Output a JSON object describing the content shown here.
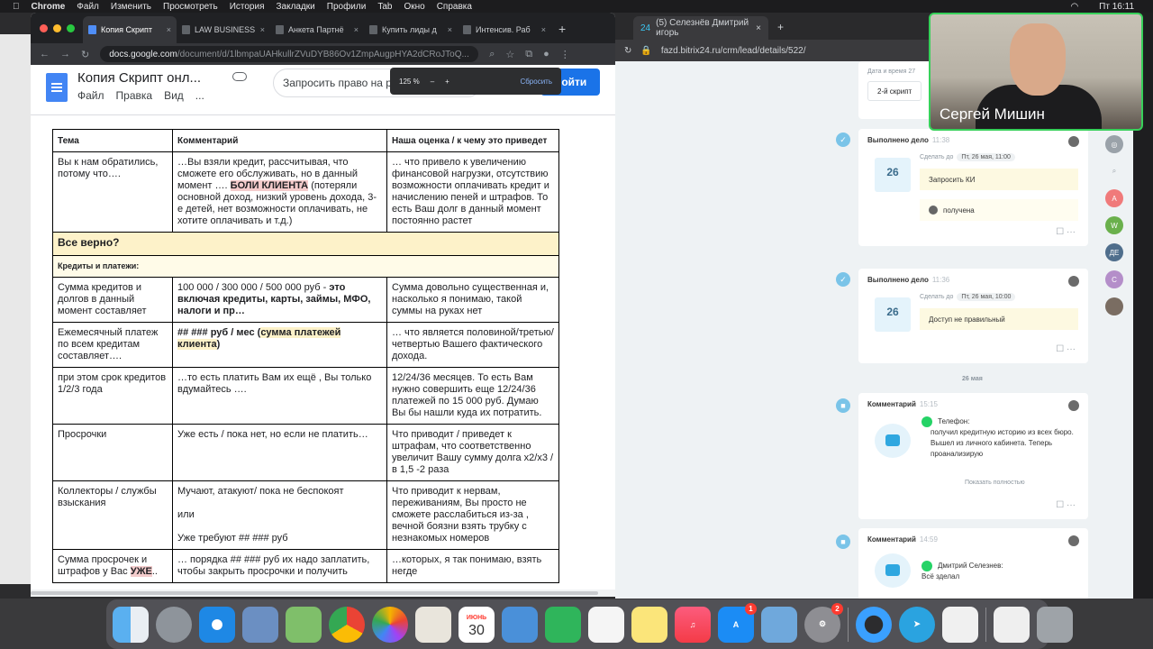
{
  "menubar": {
    "app": "Chrome",
    "items": [
      "Файл",
      "Изменить",
      "Просмотреть",
      "История",
      "Закладки",
      "Профили",
      "Tab",
      "Окно",
      "Справка"
    ],
    "clock": "Пт 16:11"
  },
  "browser_docs": {
    "tabs": [
      {
        "label": "Копия Скрипт",
        "active": true
      },
      {
        "label": "LAW BUSINESS",
        "active": false
      },
      {
        "label": "Анкета Партнё",
        "active": false
      },
      {
        "label": "Купить лиды д",
        "active": false
      },
      {
        "label": "Интенсив. Раб",
        "active": false
      }
    ],
    "new_tab": "+",
    "url_host": "docs.google.com",
    "url_path": "/document/d/1lbmpaUAHkullrZVuDYB86Ov1ZmpAugpHYA2dCRoJToQ...",
    "zoom_popup": {
      "value": "125 %",
      "minus": "–",
      "plus": "+",
      "reset": "Сбросить"
    }
  },
  "doc": {
    "title": "Копия Скрипт онл...",
    "menu": [
      "Файл",
      "Правка",
      "Вид",
      "..."
    ],
    "request_button": "Запросить право на редактирование",
    "login_button": "Войти"
  },
  "script_table": {
    "headers": [
      "Тема",
      "Комментарий",
      "Наша оценка / к чему это приведет"
    ],
    "row1": {
      "c1": "Вы к нам обратились, потому что….",
      "c2_before": "…Вы взяли кредит, рассчитывая, что сможете его обслуживать, но в данный момент ….",
      "c2_highlight": "БОЛИ КЛИЕНТА",
      "c2_after": "(потеряли основной доход, низкий уровень дохода, 3-е детей, нет возможности оплачивать, не хотите оплачивать и т.д.)",
      "c3": "… что привело к увеличению финансовой нагрузки, отсутствию возможности оплачивать кредит и начислению пеней и штрафов. То есть Ваш долг в данный момент постоянно растет"
    },
    "band1": "Все верно?",
    "band2": "Кредиты и платежи:",
    "row2": {
      "c1": "Сумма кредитов и долгов в данный момент составляет",
      "c2_plain": "100 000 / 300 000 / 500 000 руб -",
      "c2_bold": "это включая кредиты, карты, займы, МФО, налоги и пр…",
      "c3": "Сумма довольно существенная и, насколько я понимаю, такой суммы на руках нет"
    },
    "row3": {
      "c1": "Ежемесячный платеж по всем кредитам составляет….",
      "c2_plain": "## ### руб / мес (",
      "c2_highlight": "сумма платежей клиента",
      "c2_close": ")",
      "c3": "… что является половиной/третью/ четвертью Вашего фактического дохода."
    },
    "row4": {
      "c1": "при этом срок кредитов 1/2/3 года",
      "c2": "…то есть  платить Вам их ещё , Вы только вдумайтесь ….",
      "c3": "12/24/36 месяцев. То есть Вам нужно совершить еще 12/24/36 платежей по 15 000 руб. Думаю Вы бы нашли куда их потратить."
    },
    "row5": {
      "c1": "Просрочки",
      "c2": "Уже есть / пока нет, но если не платить…",
      "c3": "Что приводит / приведет к штрафам, что соответственно увеличит Вашу сумму долга х2/х3 / в 1,5 -2  раза"
    },
    "row6": {
      "c1": "Коллекторы / службы взыскания",
      "c2_line1": "Мучают, атакуют/ пока не беспокоят",
      "c2_line2": "или",
      "c2_line3": "Уже требуют  ## ### руб",
      "c3": "Что приводит к нервам, переживаниям, Вы просто не сможете расслабиться из-за , вечной боязни взять трубку с незнакомых номеров"
    },
    "row7": {
      "c1_plain": "Сумма просрочек и штрафов у Вас",
      "c1_highlight": "УЖЕ",
      "c1_tail": "..",
      "c2": "… порядка ## ### руб их надо заплатить, чтобы закрыть просрочки и получить",
      "c3": "…которых, я так понимаю, взять негде"
    }
  },
  "browser_crm": {
    "tab_label": "(5) Селезнёв Дмитрий игорь",
    "tab_count": "24",
    "new_tab": "+",
    "url": "fazd.bitrix24.ru/crm/lead/details/522/"
  },
  "crm": {
    "top_card": {
      "label": "Дата и время 27",
      "value": "2-й скрипт"
    },
    "activity1": {
      "title": "Выполнено дело",
      "time": "11:38",
      "do_label": "Сделать до",
      "date": "Пт, 26 мая, 11:00",
      "cal_day": "26",
      "task": "Запросить КИ",
      "note": "получена"
    },
    "activity2": {
      "title": "Выполнено дело",
      "time": "11:36",
      "do_label": "Сделать до",
      "date": "Пт, 26 мая, 10:00",
      "cal_day": "26",
      "task": "Доступ не правильный"
    },
    "day_divider": "26 мая",
    "comment1": {
      "title": "Комментарий",
      "time": "15:15",
      "line1": "Телефон:",
      "line2": "получил кредитную историю из всех бюро. Вышел из личного кабинета. Теперь проанализирую",
      "show_all": "Показать полностью"
    },
    "comment2": {
      "title": "Комментарий",
      "time": "14:59",
      "author": "Дмитрий Селезнев:",
      "text": "Всё зделал"
    },
    "side_avatars": [
      "А",
      "W",
      "ДЕ",
      "С"
    ]
  },
  "video": {
    "name": "Сергей Мишин"
  },
  "dock": {
    "calendar_month": "ИЮНЬ",
    "calendar_day": "30",
    "appstore_badge": "1",
    "settings_badge": "2"
  }
}
